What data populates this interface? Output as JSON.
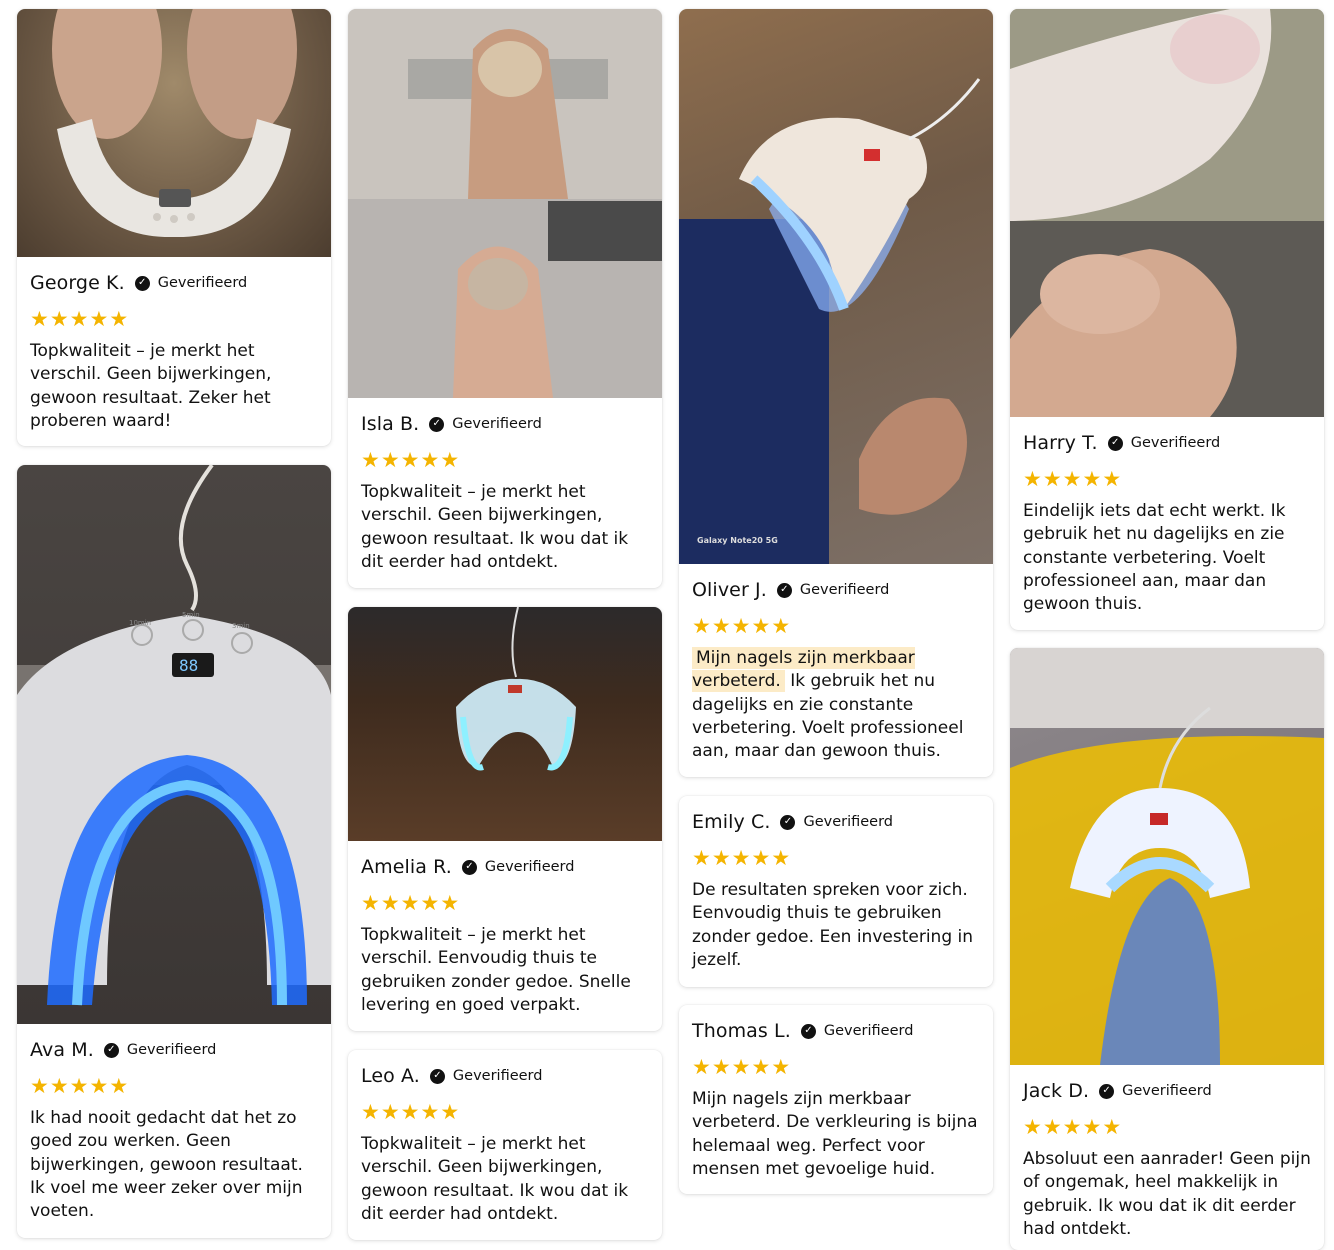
{
  "verified_label": "Geverifieerd",
  "colors": {
    "star": "#f4b400",
    "highlight": "#fcebc7",
    "check_badge": "#111111"
  },
  "reviews": [
    {
      "name": "George K.",
      "rating": 5,
      "text": "Topkwaliteit – je merkt het verschil. Geen bijwerkingen, gewoon resultaat. Zeker het proberen waard!"
    },
    {
      "name": "Ava M.",
      "rating": 5,
      "text": "Ik had nooit gedacht dat het zo goed zou werken. Geen bijwerkingen, gewoon resultaat. Ik voel me weer zeker over mijn voeten."
    },
    {
      "name": "Isla B.",
      "rating": 5,
      "text": "Topkwaliteit – je merkt het verschil. Geen bijwerkingen, gewoon resultaat. Ik wou dat ik dit eerder had ontdekt."
    },
    {
      "name": "Amelia R.",
      "rating": 5,
      "text": "Topkwaliteit – je merkt het verschil. Eenvoudig thuis te gebruiken zonder gedoe. Snelle levering en goed verpakt."
    },
    {
      "name": "Leo A.",
      "rating": 5,
      "text": "Topkwaliteit – je merkt het verschil. Geen bijwerkingen, gewoon resultaat. Ik wou dat ik dit eerder had ontdekt."
    },
    {
      "name": "Oliver J.",
      "rating": 5,
      "highlight": "Mijn nagels zijn merkbaar verbeterd.",
      "text": "Ik gebruik het nu dagelijks en zie constante verbetering. Voelt professioneel aan, maar dan gewoon thuis."
    },
    {
      "name": "Emily C.",
      "rating": 5,
      "text": "De resultaten spreken voor zich. Eenvoudig thuis te gebruiken zonder gedoe. Een investering in jezelf."
    },
    {
      "name": "Thomas L.",
      "rating": 5,
      "text": "Mijn nagels zijn merkbaar verbeterd. De verkleuring is bijna helemaal weg. Perfect voor mensen met gevoelige huid."
    },
    {
      "name": "Harry T.",
      "rating": 5,
      "text": "Eindelijk iets dat echt werkt. Ik gebruik het nu dagelijks en zie constante verbetering. Voelt professioneel aan, maar dan gewoon thuis."
    },
    {
      "name": "Jack D.",
      "rating": 5,
      "text": "Absoluut een aanrader! Geen pijn of ongemak, heel makkelijk in gebruik. Ik wou dat ik dit eerder had ontdekt."
    }
  ],
  "photo_overlays": {
    "ava_device_timers": [
      "10min",
      "5min",
      "3min"
    ],
    "ava_device_display": "88",
    "oliver_watermark": "Galaxy Note20 5G"
  }
}
